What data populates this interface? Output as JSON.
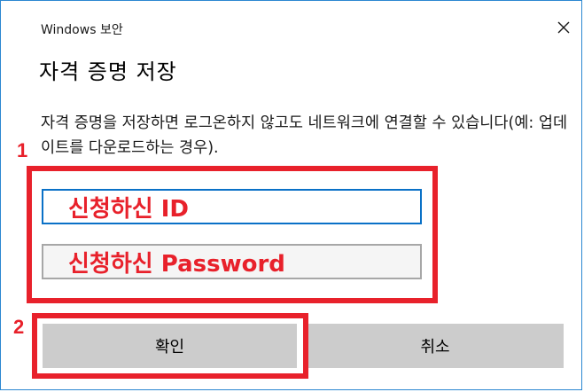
{
  "dialog": {
    "window_title": "Windows 보안",
    "close_icon": "close-icon",
    "heading": "자격 증명 저장",
    "description": "자격 증명을 저장하면 로그온하지 않고도 네트워크에 연결할 수 있습니다(예: 업데이트를 다운로드하는 경우)."
  },
  "fields": {
    "id_value": "신청하신 ID",
    "password_value": "신청하신 Password"
  },
  "buttons": {
    "ok_label": "확인",
    "cancel_label": "취소"
  },
  "annotations": {
    "marker_1": "1",
    "marker_2": "2",
    "accent_color": "#e8212b"
  }
}
